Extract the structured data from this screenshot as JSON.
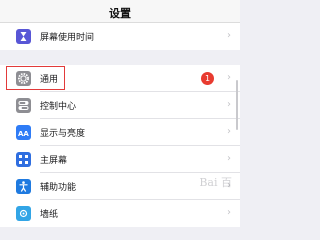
{
  "nav": {
    "title": "设置"
  },
  "group1": [
    {
      "label": "屏幕使用时间",
      "icon": "hourglass-icon",
      "color": "#5856d6"
    }
  ],
  "group2": [
    {
      "label": "通用",
      "icon": "gear-icon",
      "color": "#8e8e93",
      "badge": "1"
    },
    {
      "label": "控制中心",
      "icon": "switches-icon",
      "color": "#8e8e93"
    },
    {
      "label": "显示与亮度",
      "icon": "text-size-icon",
      "color": "#2f7cf6"
    },
    {
      "label": "主屏幕",
      "icon": "home-grid-icon",
      "color": "#2f6ee0"
    },
    {
      "label": "辅助功能",
      "icon": "accessibility-icon",
      "color": "#1f7ae0"
    },
    {
      "label": "墙纸",
      "icon": "wallpaper-icon",
      "color": "#32a5e6"
    }
  ],
  "watermark": "Bai 百"
}
